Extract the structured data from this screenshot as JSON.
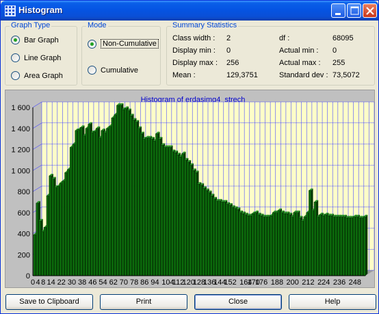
{
  "window": {
    "title": "Histogram"
  },
  "graph_type": {
    "label": "Graph Type",
    "options": [
      "Bar Graph",
      "Line Graph",
      "Area Graph"
    ],
    "selected": 0
  },
  "mode": {
    "label": "Mode",
    "options": [
      "Non-Cumulative",
      "Cumulative"
    ],
    "selected": 0
  },
  "summary": {
    "label": "Summary Statistics",
    "class_width_label": "Class width :",
    "class_width": "2",
    "display_min_label": "Display min :",
    "display_min": "0",
    "display_max_label": "Display max :",
    "display_max": "256",
    "mean_label": "Mean :",
    "mean": "129,3751",
    "df_label": "df :",
    "df": "68095",
    "actual_min_label": "Actual min :",
    "actual_min": "0",
    "actual_max_label": "Actual max :",
    "actual_max": "255",
    "std_label": "Standard dev :",
    "std": "73,5072"
  },
  "buttons": {
    "clipboard": "Save to Clipboard",
    "print": "Print",
    "close": "Close",
    "help": "Help"
  },
  "colors": {
    "plot_bg": "#ffffc8",
    "grid": "#4a4aff",
    "bar_fill": "#0c6b0c",
    "bar_edge": "#002800",
    "title": "#0000cc"
  },
  "chart_data": {
    "type": "bar",
    "title": "Histogram of erdasimg4_strech",
    "xlabel": "",
    "ylabel": "",
    "ylim": [
      0,
      1600
    ],
    "xlim": [
      0,
      256
    ],
    "grid": true,
    "yticks": [
      0,
      200,
      400,
      600,
      800,
      1000,
      1200,
      1400,
      1600
    ],
    "xticks": [
      0,
      4,
      8,
      14,
      22,
      30,
      38,
      46,
      54,
      62,
      70,
      78,
      86,
      94,
      104,
      112,
      120,
      128,
      136,
      144,
      152,
      164,
      170,
      176,
      188,
      200,
      212,
      224,
      236,
      248
    ],
    "ytick_labels": [
      "0",
      "200",
      "400",
      "600",
      "800",
      "1 000",
      "1 200",
      "1 400",
      "1 600"
    ],
    "x": [
      0,
      2,
      4,
      6,
      8,
      10,
      12,
      14,
      16,
      18,
      20,
      22,
      24,
      26,
      28,
      30,
      32,
      34,
      36,
      38,
      40,
      42,
      44,
      46,
      48,
      50,
      52,
      54,
      56,
      58,
      60,
      62,
      64,
      66,
      68,
      70,
      72,
      74,
      76,
      78,
      80,
      82,
      84,
      86,
      88,
      90,
      92,
      94,
      96,
      98,
      100,
      102,
      104,
      106,
      108,
      110,
      112,
      114,
      116,
      118,
      120,
      122,
      124,
      126,
      128,
      130,
      132,
      134,
      136,
      138,
      140,
      142,
      144,
      146,
      148,
      150,
      152,
      154,
      156,
      158,
      160,
      162,
      164,
      166,
      168,
      170,
      172,
      174,
      176,
      178,
      180,
      182,
      184,
      186,
      188,
      190,
      192,
      194,
      196,
      198,
      200,
      202,
      204,
      206,
      208,
      210,
      212,
      214,
      216,
      218,
      220,
      222,
      224,
      226,
      228,
      230,
      232,
      234,
      236,
      238,
      240,
      242,
      244,
      246,
      248,
      250,
      252,
      254
    ],
    "values": [
      390,
      690,
      520,
      420,
      460,
      760,
      950,
      920,
      840,
      850,
      880,
      900,
      980,
      1010,
      1220,
      1250,
      1380,
      1390,
      1410,
      1330,
      1400,
      1440,
      1360,
      1370,
      1400,
      1310,
      1380,
      1360,
      1400,
      1420,
      1500,
      1530,
      1620,
      1620,
      1580,
      1590,
      1570,
      1520,
      1480,
      1460,
      1400,
      1350,
      1300,
      1310,
      1310,
      1300,
      1280,
      1350,
      1300,
      1240,
      1220,
      1220,
      1220,
      1180,
      1170,
      1150,
      1130,
      1160,
      1100,
      1080,
      1050,
      1000,
      980,
      870,
      860,
      830,
      810,
      790,
      760,
      730,
      710,
      710,
      700,
      700,
      680,
      670,
      650,
      640,
      630,
      600,
      590,
      580,
      570,
      570,
      590,
      600,
      580,
      570,
      560,
      560,
      560,
      570,
      600,
      600,
      620,
      600,
      590,
      590,
      580,
      560,
      600,
      600,
      550,
      520,
      560,
      600,
      810,
      620,
      700,
      560,
      580,
      570,
      580,
      570,
      570,
      560,
      560,
      560,
      560,
      560,
      550,
      550,
      550,
      560,
      560,
      550,
      550,
      560
    ]
  }
}
